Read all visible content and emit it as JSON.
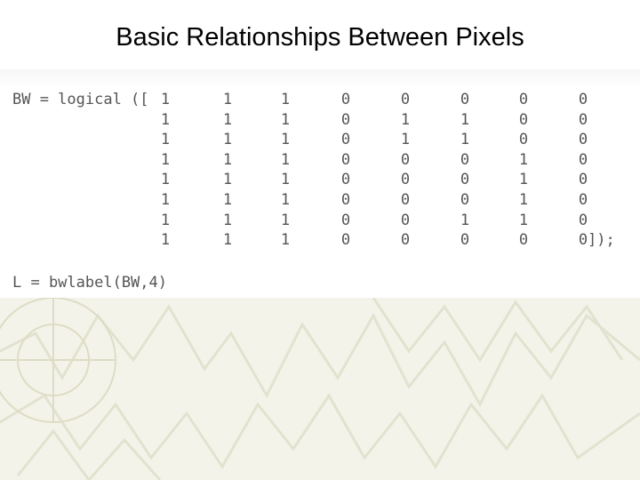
{
  "slide": {
    "title": "Basic Relationships Between Pixels"
  },
  "code": {
    "bw_prefix": "BW = logical ([",
    "matrix": [
      [
        "1",
        "1",
        "1",
        "0",
        "0",
        "0",
        "0",
        "0"
      ],
      [
        "1",
        "1",
        "1",
        "0",
        "1",
        "1",
        "0",
        "0"
      ],
      [
        "1",
        "1",
        "1",
        "0",
        "1",
        "1",
        "0",
        "0"
      ],
      [
        "1",
        "1",
        "1",
        "0",
        "0",
        "0",
        "1",
        "0"
      ],
      [
        "1",
        "1",
        "1",
        "0",
        "0",
        "0",
        "1",
        "0"
      ],
      [
        "1",
        "1",
        "1",
        "0",
        "0",
        "0",
        "1",
        "0"
      ],
      [
        "1",
        "1",
        "1",
        "0",
        "0",
        "1",
        "1",
        "0"
      ],
      [
        "1",
        "1",
        "1",
        "0",
        "0",
        "0",
        "0",
        "0"
      ]
    ],
    "closing": "]);",
    "label_line": "L = bwlabel(BW,4)"
  },
  "colors": {
    "code_text": "#555555",
    "background_pattern": "#f3f3ea"
  }
}
